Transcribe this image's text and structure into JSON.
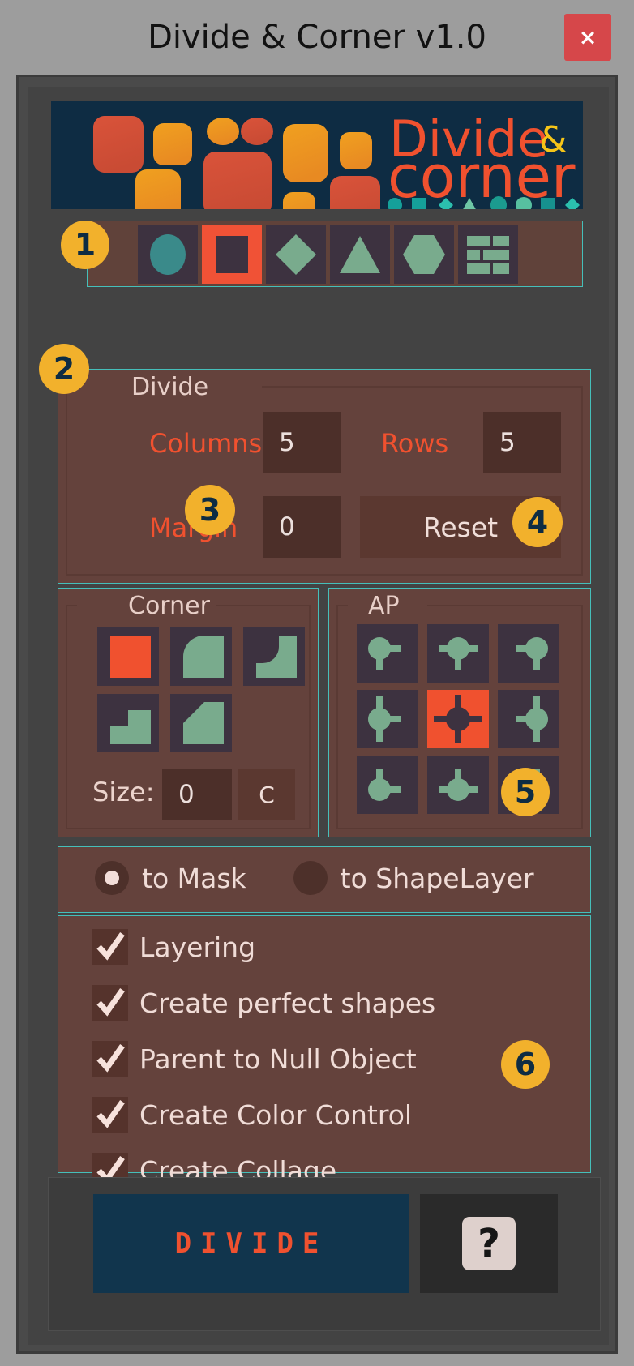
{
  "window": {
    "title": "Divide & Corner v1.0",
    "close_label": "×"
  },
  "logo": {
    "line1": "Divide",
    "amp": "&",
    "line2": "corner"
  },
  "shape_toolbar": {
    "shapes": [
      {
        "name": "ellipse-shape",
        "icon": "ellipse-icon",
        "selected": false
      },
      {
        "name": "rectangle-shape",
        "icon": "square-icon",
        "selected": true
      },
      {
        "name": "diamond-shape",
        "icon": "diamond-icon",
        "selected": false
      },
      {
        "name": "triangle-shape",
        "icon": "triangle-icon",
        "selected": false
      },
      {
        "name": "hexagon-shape",
        "icon": "hexagon-icon",
        "selected": false
      },
      {
        "name": "brick-shape",
        "icon": "brick-grid-icon",
        "selected": false
      }
    ]
  },
  "divide": {
    "legend": "Divide",
    "columns_label": "Columns",
    "columns_value": "5",
    "rows_label": "Rows",
    "rows_value": "5",
    "margin_label": "Margin",
    "margin_value": "0",
    "reset_label": "Reset"
  },
  "corner": {
    "legend": "Corner",
    "size_label": "Size:",
    "size_value": "0",
    "c_button_label": "C",
    "options": [
      {
        "name": "corner-none",
        "selected": true
      },
      {
        "name": "corner-round",
        "selected": false
      },
      {
        "name": "corner-inverted-round",
        "selected": false
      },
      {
        "name": "corner-step",
        "selected": false
      },
      {
        "name": "corner-bevel",
        "selected": false
      }
    ]
  },
  "ap": {
    "legend": "AP",
    "options": [
      {
        "name": "anchor-top-left",
        "selected": false
      },
      {
        "name": "anchor-top-center",
        "selected": false
      },
      {
        "name": "anchor-top-right",
        "selected": false
      },
      {
        "name": "anchor-middle-left",
        "selected": false
      },
      {
        "name": "anchor-center",
        "selected": true
      },
      {
        "name": "anchor-middle-right",
        "selected": false
      },
      {
        "name": "anchor-bottom-left",
        "selected": false
      },
      {
        "name": "anchor-bottom-center",
        "selected": false
      },
      {
        "name": "anchor-bottom-right",
        "selected": false
      }
    ]
  },
  "output_mode": {
    "options": [
      {
        "label": "to Mask",
        "selected": true
      },
      {
        "label": "to ShapeLayer",
        "selected": false
      }
    ]
  },
  "checkboxes": [
    {
      "label": "Layering",
      "checked": true
    },
    {
      "label": "Create perfect shapes",
      "checked": true
    },
    {
      "label": "Parent to Null Object",
      "checked": true
    },
    {
      "label": "Create Color Control",
      "checked": true
    },
    {
      "label": "Create Collage",
      "checked": true
    }
  ],
  "footer": {
    "divide_label": "DIVIDE",
    "help_label": "?"
  },
  "badges": [
    "1",
    "2",
    "3",
    "4",
    "5",
    "6"
  ],
  "colors": {
    "accent_orange": "#f0512f",
    "badge_yellow": "#f2b12c",
    "panel_brown": "#64423c",
    "teal_border": "#45bfba",
    "navy": "#0e2c43",
    "green": "#79ab8d",
    "close_red": "#d6474a"
  }
}
